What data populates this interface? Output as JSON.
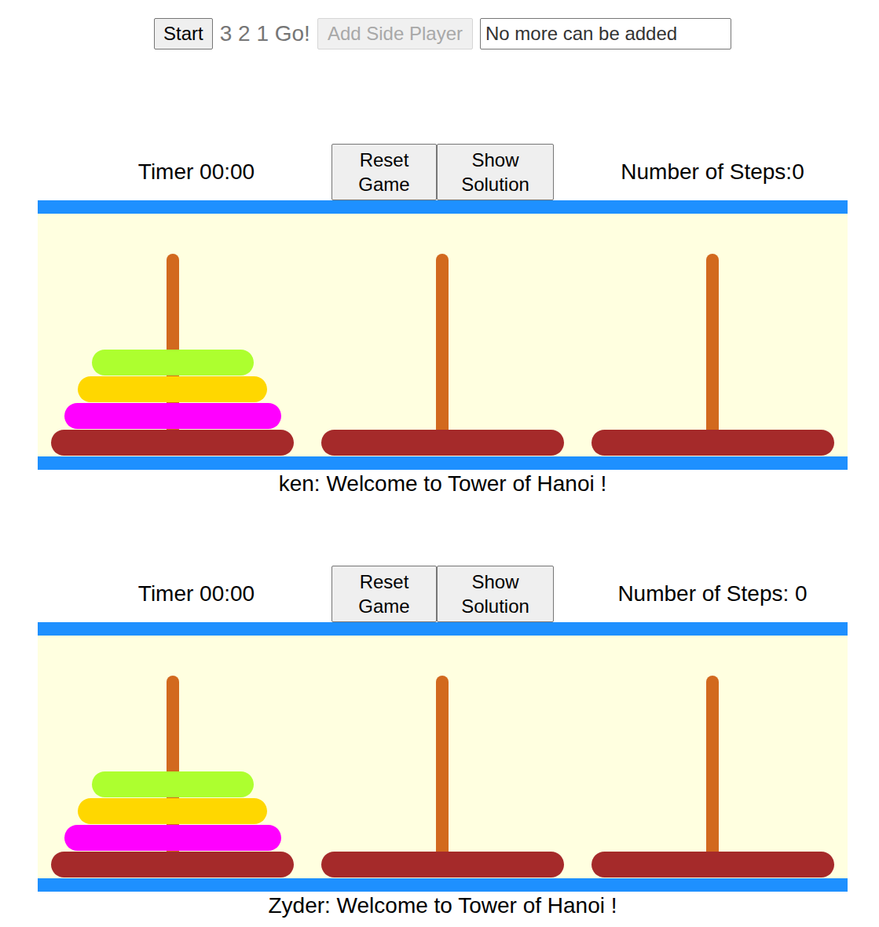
{
  "toolbar": {
    "start_button": "Start",
    "countdown": "3 2 1 Go!",
    "add_button": {
      "label": "Add Side Player",
      "disabled": true
    },
    "name_field": {
      "value": "No more can be added"
    }
  },
  "games": [
    {
      "timer": "Timer 00:00",
      "buttons": [
        "Reset Game",
        "Show Solution"
      ],
      "steps": "Number of Steps:0",
      "message": "ken: Welcome to Tower of Hanoi !",
      "towers": [
        {
          "disks": [
            {
              "color": "#adff2f",
              "size": 1
            },
            {
              "color": "#ffd700",
              "size": 2
            },
            {
              "color": "#ff00ff",
              "size": 3
            }
          ]
        },
        {
          "disks": []
        },
        {
          "disks": []
        }
      ]
    },
    {
      "timer": "Timer 00:00",
      "buttons": [
        "Reset Game",
        "Show Solution"
      ],
      "steps": "Number of Steps: 0",
      "message": "Zyder: Welcome to Tower of Hanoi !",
      "towers": [
        {
          "disks": [
            {
              "color": "#adff2f",
              "size": 1
            },
            {
              "color": "#ffd700",
              "size": 2
            },
            {
              "color": "#ff00ff",
              "size": 3
            }
          ]
        },
        {
          "disks": []
        },
        {
          "disks": []
        }
      ]
    }
  ]
}
